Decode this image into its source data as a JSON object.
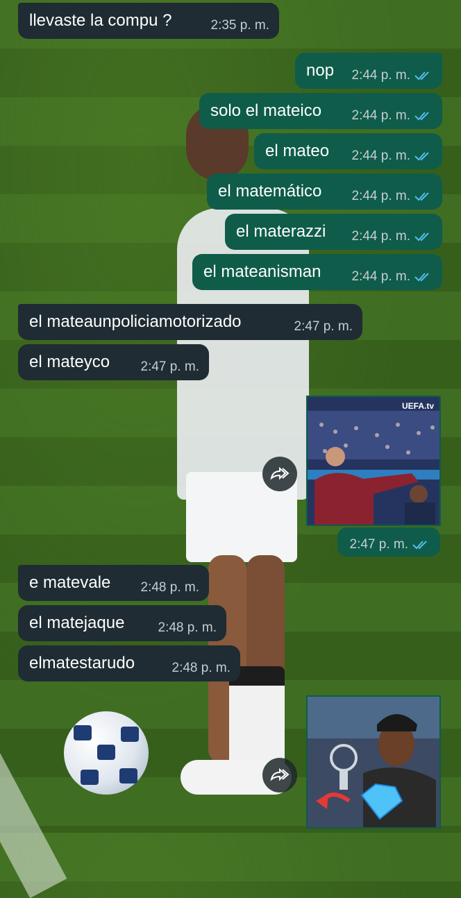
{
  "chat": {
    "messages": [
      {
        "dir": "in",
        "text": "llevaste la compu ?",
        "time": "2:35 p. m."
      },
      {
        "dir": "out",
        "text": "nop",
        "time": "2:44 p. m."
      },
      {
        "dir": "out",
        "text": "solo el mateico",
        "time": "2:44 p. m."
      },
      {
        "dir": "out",
        "text": "el mateo",
        "time": "2:44 p. m."
      },
      {
        "dir": "out",
        "text": "el matemático",
        "time": "2:44 p. m."
      },
      {
        "dir": "out",
        "text": "el materazzi",
        "time": "2:44 p. m."
      },
      {
        "dir": "out",
        "text": "el mateanisman",
        "time": "2:44 p. m."
      },
      {
        "dir": "in",
        "text": "el mateaunpoliciamotorizado",
        "time": "2:47 p. m."
      },
      {
        "dir": "in",
        "text": "el mateyco",
        "time": "2:47 p. m."
      },
      {
        "dir": "out",
        "text": "",
        "time": "2:47 p. m."
      },
      {
        "dir": "in",
        "text": "e matevale",
        "time": "2:48 p. m."
      },
      {
        "dir": "in",
        "text": "el matejaque",
        "time": "2:48 p. m."
      },
      {
        "dir": "in",
        "text": "elmatestarudo",
        "time": "2:48 p. m."
      }
    ],
    "media_1": {
      "watermark": "UEFA.tv",
      "time": "2:47 p. m."
    },
    "colors": {
      "incoming_bubble": "#1f2c33",
      "outgoing_bubble": "#0f5c4a",
      "read_ticks": "#53bdeb",
      "timestamp": "#c7ced2"
    },
    "icons": [
      "double-check-icon",
      "forward-icon",
      "diamond-icon",
      "arrow-icon"
    ]
  }
}
